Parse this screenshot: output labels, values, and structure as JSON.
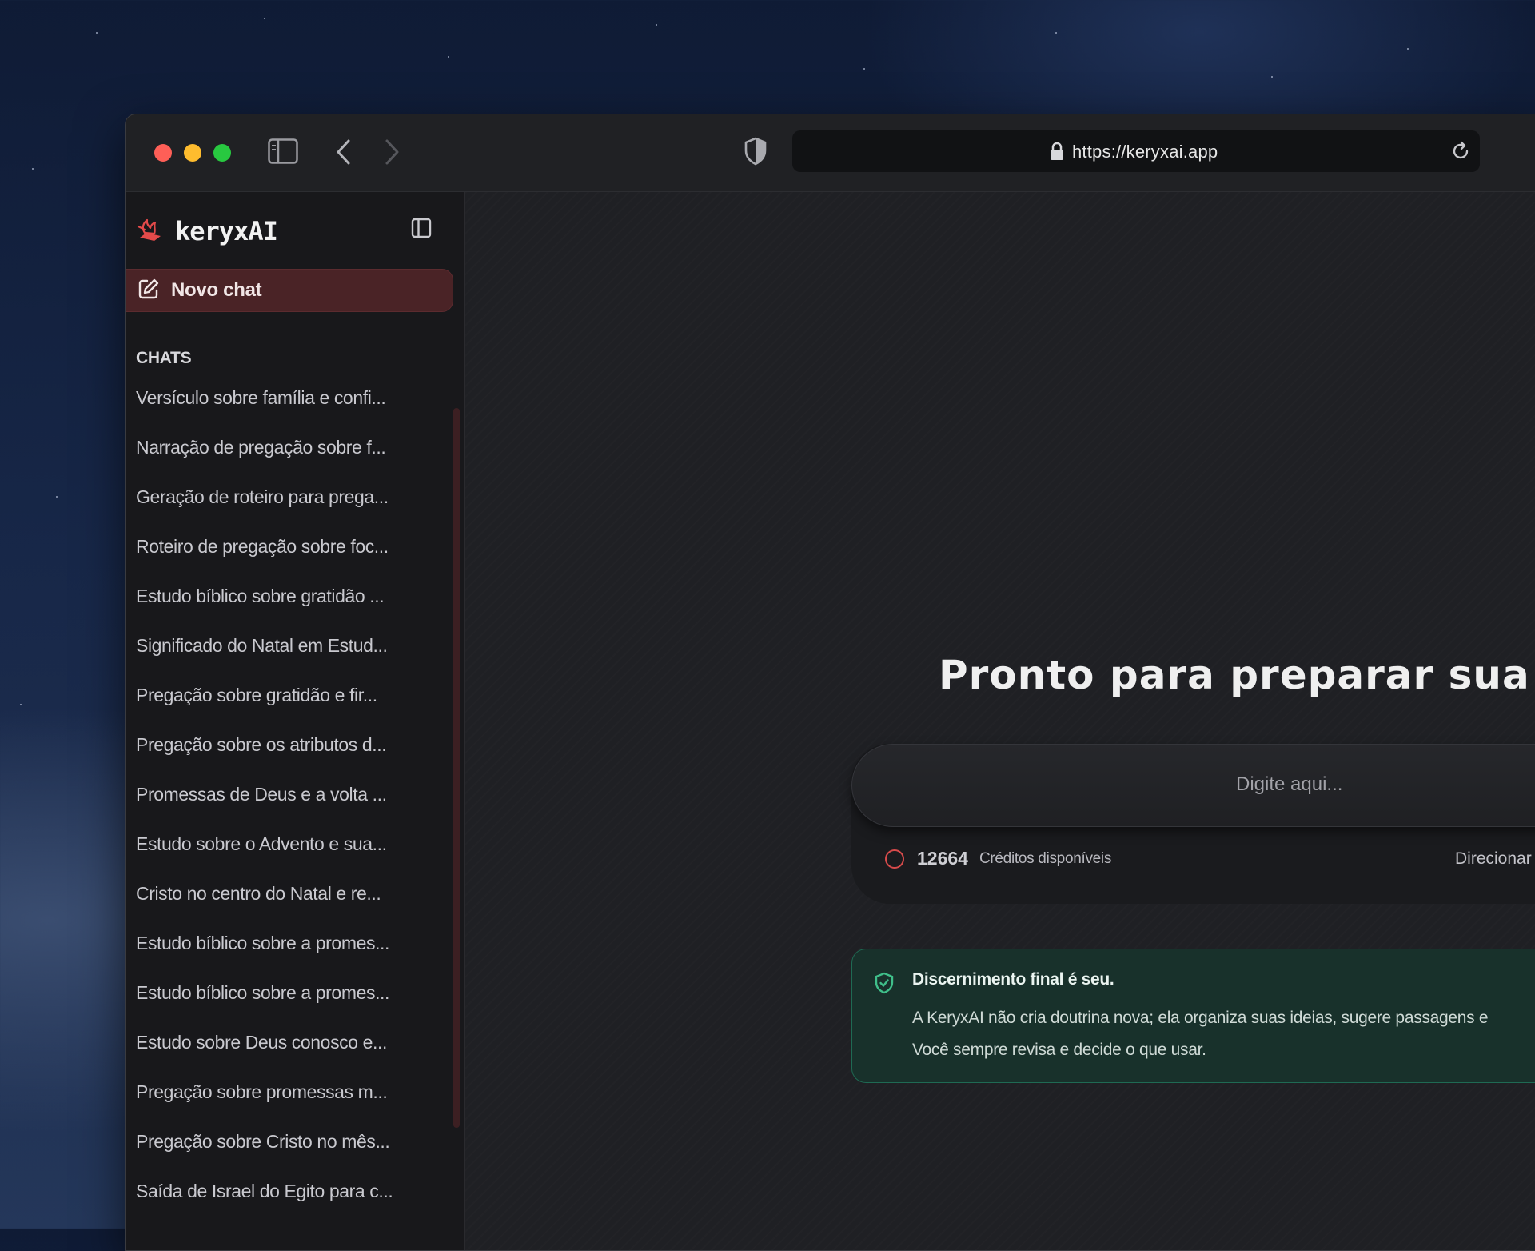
{
  "browser": {
    "url": "https://keryxai.app"
  },
  "sidebar": {
    "brand": "keryxAI",
    "new_chat_label": "Novo chat",
    "section_label": "CHATS",
    "chats": [
      "Versículo sobre família e confi...",
      "Narração de pregação sobre f...",
      "Geração de roteiro para prega...",
      "Roteiro de pregação sobre foc...",
      "Estudo bíblico sobre gratidão ...",
      "Significado do Natal em Estud...",
      "Pregação sobre gratidão e fir...",
      "Pregação sobre os atributos d...",
      "Promessas de Deus e a volta ...",
      "Estudo sobre o Advento e sua...",
      "Cristo no centro do Natal e re...",
      "Estudo bíblico sobre a promes...",
      "Estudo bíblico sobre a promes...",
      "Estudo sobre Deus conosco e...",
      "Pregação sobre promessas m...",
      "Pregação sobre Cristo no mês...",
      "Saída de Israel do Egito para c..."
    ]
  },
  "main": {
    "headline": "Pronto para preparar sua mens",
    "input_placeholder": "Digite aqui...",
    "credits_value": "12664",
    "credits_label": "Créditos disponíveis",
    "direcionar_label": "Direcionar",
    "notice_title": "Discernimento final é seu.",
    "notice_line1": "A KeryxAI não cria doutrina nova; ela organiza suas ideias, sugere passagens e",
    "notice_line2": "Você sempre revisa e decide o que usar."
  },
  "colors": {
    "accent": "#4a2326",
    "notice_border": "#1f6a53",
    "credit_ring": "#d84b4b"
  }
}
